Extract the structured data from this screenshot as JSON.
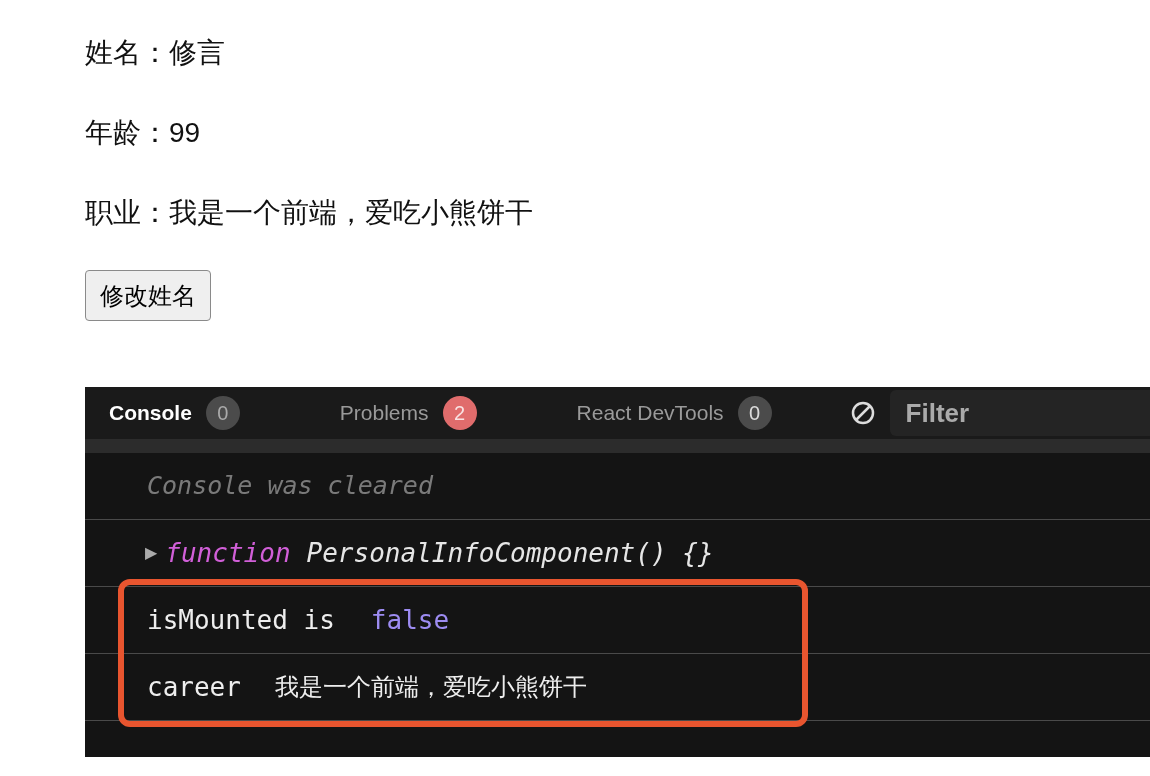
{
  "fields": [
    {
      "label": "姓名：",
      "value": "修言"
    },
    {
      "label": "年龄：",
      "value": "99"
    },
    {
      "label": "职业：",
      "value": "我是一个前端，爱吃小熊饼干"
    }
  ],
  "button": "修改姓名",
  "console": {
    "tabs": [
      {
        "label": "Console",
        "count": "0",
        "selected": true,
        "color": "#4b4b4b"
      },
      {
        "label": "Problems",
        "count": "2",
        "selected": false,
        "color": "#e06c6c"
      },
      {
        "label": "React DevTools",
        "count": "0",
        "selected": false,
        "color": "#4b4b4b"
      }
    ],
    "filter": {
      "placeholder": "Filter"
    },
    "entries": [
      {
        "kind": "notice",
        "text": "Console was cleared",
        "highlighted": false
      },
      {
        "kind": "function",
        "expand": "▶",
        "keyword": "function",
        "text": "PersonalInfoComponent() {}",
        "highlighted": false
      },
      {
        "kind": "boolean",
        "text": "isMounted is",
        "value": "false",
        "highlighted": true
      },
      {
        "kind": "string",
        "text": "career",
        "value": "我是一个前端，爱吃小熊饼干",
        "highlighted": true
      }
    ]
  }
}
